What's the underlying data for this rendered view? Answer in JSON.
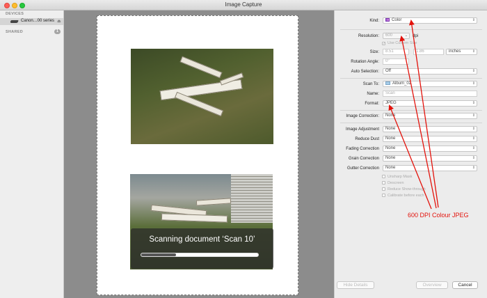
{
  "window": {
    "title": "Image Capture"
  },
  "sidebar": {
    "devices_heading": "DEVICES",
    "device_name": "Canon…00 series",
    "shared_heading": "SHARED",
    "shared_count": "1"
  },
  "preview": {
    "status_text": "Scanning document ‘Scan 10’",
    "progress": 0.3
  },
  "settings": {
    "kind": {
      "label": "Kind:",
      "value": "Color"
    },
    "resolution": {
      "label": "Resolution:",
      "value": "600",
      "unit": "dpi"
    },
    "custom_size": "Use Custom Size",
    "size": {
      "label": "Size:",
      "width": "8.51",
      "height": "1.86",
      "unit": "inches"
    },
    "rotation": {
      "label": "Rotation Angle:",
      "value": "0°"
    },
    "auto_selection": {
      "label": "Auto Selection:",
      "value": "Off"
    },
    "scan_to": {
      "label": "Scan To:",
      "value": "Album_02"
    },
    "name": {
      "label": "Name:",
      "placeholder": "Scan"
    },
    "format": {
      "label": "Format:",
      "value": "JPEG"
    },
    "image_correction": {
      "label": "Image Correction:",
      "value": "None"
    },
    "image_adjustment": {
      "label": "Image Adjustment",
      "value": "None"
    },
    "reduce_dust": {
      "label": "Reduce Dust",
      "value": "None"
    },
    "fading_correction": {
      "label": "Fading Correction",
      "value": "None"
    },
    "grain_correction": {
      "label": "Grain Correction",
      "value": "None"
    },
    "gutter_correction": {
      "label": "Gutter Correction",
      "value": "None"
    },
    "checkboxes": [
      "Unsharp Mask",
      "Descreen",
      "Reduce Show-through",
      "Calibrate before each"
    ]
  },
  "buttons": {
    "hide_details": "Hide Details",
    "overview": "Overview",
    "cancel": "Cancel"
  },
  "annotation": {
    "text": "600 DPI Colour JPEG",
    "color": "#e3120b"
  },
  "colors": {
    "sidebar_selection": "#d5d5d5",
    "preview_bg": "#8c8c8c",
    "annotation_red": "#e3120b"
  }
}
